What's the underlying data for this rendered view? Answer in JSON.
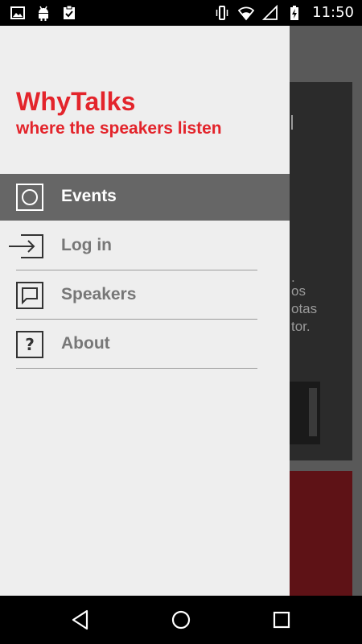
{
  "status_bar": {
    "time": "11:50",
    "left_icons": [
      "image-icon",
      "android-icon",
      "clipboard-check-icon"
    ],
    "right_icons": [
      "vibrate-icon",
      "wifi-icon",
      "no-signal-icon",
      "battery-charging-icon"
    ]
  },
  "drawer": {
    "brand_title": "WhyTalks",
    "brand_subtitle": "where the speakers listen",
    "items": [
      {
        "label": "Events",
        "icon": "circle-square-icon",
        "active": true
      },
      {
        "label": "Log in",
        "icon": "login-arrow-icon",
        "active": false
      },
      {
        "label": "Speakers",
        "icon": "speech-bubble-icon",
        "active": false
      },
      {
        "label": "About",
        "icon": "question-box-icon",
        "active": false
      }
    ]
  },
  "background": {
    "text_lines": [
      ".",
      "os",
      "otas",
      "tor."
    ]
  },
  "nav_bar": {
    "buttons": [
      "back-icon",
      "home-icon",
      "recents-icon"
    ]
  },
  "colors": {
    "brand": "#e3242b",
    "drawer_bg": "#eeeeee",
    "active_item_bg": "#666666",
    "inactive_label": "#777777"
  }
}
